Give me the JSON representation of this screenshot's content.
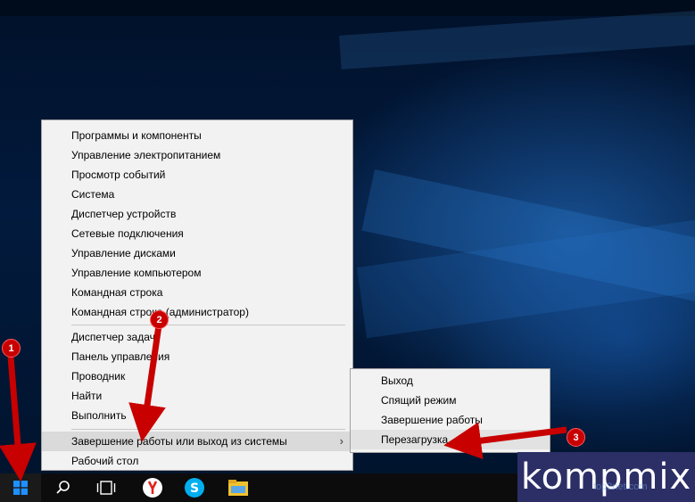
{
  "menu": {
    "items": [
      {
        "label": "Программы и компоненты"
      },
      {
        "label": "Управление электропитанием"
      },
      {
        "label": "Просмотр событий"
      },
      {
        "label": "Система"
      },
      {
        "label": "Диспетчер устройств"
      },
      {
        "label": "Сетевые подключения"
      },
      {
        "label": "Управление дисками"
      },
      {
        "label": "Управление компьютером"
      },
      {
        "label": "Командная строка"
      },
      {
        "label": "Командная строка (администратор)"
      },
      {
        "label": "Диспетчер задач"
      },
      {
        "label": "Панель управления"
      },
      {
        "label": "Проводник"
      },
      {
        "label": "Найти"
      },
      {
        "label": "Выполнить"
      },
      {
        "label": "Завершение работы или выход из системы"
      },
      {
        "label": "Рабочий стол"
      }
    ]
  },
  "submenu": {
    "items": [
      {
        "label": "Выход"
      },
      {
        "label": "Спящий режим"
      },
      {
        "label": "Завершение работы"
      },
      {
        "label": "Перезагрузка"
      }
    ]
  },
  "annotations": {
    "step1": "1",
    "step2": "2",
    "step3": "3"
  },
  "brand": {
    "logo_text": "kompmix",
    "watermark": "top2net.com"
  },
  "colors": {
    "accent": "#c80000",
    "menu_bg": "#f2f2f2",
    "highlight": "#dadada",
    "taskbar": "#0c0c0c"
  },
  "taskbar": {
    "icons": [
      "windows-logo-icon",
      "search-icon",
      "task-view-icon",
      "yandex-browser-icon",
      "skype-icon",
      "file-explorer-icon"
    ]
  }
}
